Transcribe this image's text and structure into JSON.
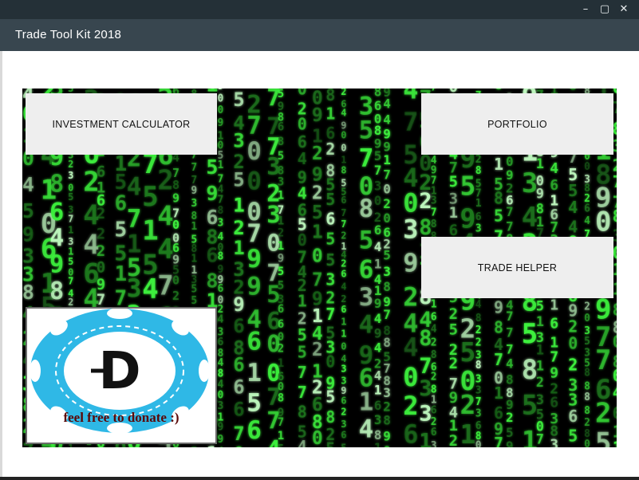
{
  "window": {
    "title": "Trade Tool Kit 2018",
    "controls": {
      "minimize": "–",
      "maximize": "▢",
      "close": "✕"
    }
  },
  "buttons": {
    "investment_calculator": "INVESTMENT CALCULATOR",
    "portfolio": "PORTFOLIO",
    "trade_helper": "TRADE HELPER"
  },
  "donate": {
    "caption": "feel free to donate :)",
    "coin_letter": "D",
    "colors": {
      "chip": "#2fb8e6",
      "ink": "#111111",
      "caption": "#5a0808"
    }
  },
  "background": {
    "icon": "matrix-digits-background",
    "colors": {
      "base": "#000000",
      "digit": "#3df03d",
      "digit_dim": "#1f7a1f",
      "digit_light": "#bdf7bd"
    }
  }
}
